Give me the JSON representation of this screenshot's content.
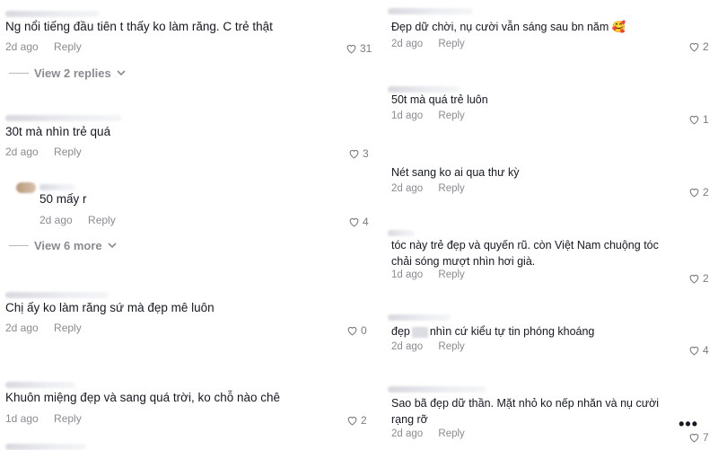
{
  "left_comments": [
    {
      "text": "Ng nổi tiếng đầu tiên t thấy ko làm răng. C trẻ thật",
      "time": "2d ago",
      "reply": "Reply",
      "likes": "31"
    },
    {
      "text": "30t mà nhìn trẻ quá",
      "time": "2d ago",
      "reply": "Reply",
      "likes": "3"
    },
    {
      "text": "50 mấy r",
      "time": "2d ago",
      "reply": "Reply",
      "likes": "4"
    },
    {
      "text": "Chị ấy ko làm răng sứ mà đẹp mê luôn",
      "time": "2d ago",
      "reply": "Reply",
      "likes": "0"
    },
    {
      "text": "Khuôn miệng đẹp và sang quá trời, ko chỗ nào chê",
      "time": "1d ago",
      "reply": "Reply",
      "likes": "2"
    }
  ],
  "view_replies": [
    "View 2 replies",
    "View 6 more"
  ],
  "right_comments": [
    {
      "text": "Đẹp dữ chời, nụ cười vẫn sáng sau bn năm 🥰",
      "time": "2d ago",
      "reply": "Reply",
      "likes": "2"
    },
    {
      "text": "50t mà quá trẻ luôn",
      "time": "1d ago",
      "reply": "Reply",
      "likes": "1"
    },
    {
      "text": "Nét sang ko ai qua thư kỳ",
      "time": "2d ago",
      "reply": "Reply",
      "likes": "2"
    },
    {
      "text": "tóc này trẻ đẹp và quyến rũ. còn Việt Nam chuộng tóc chải sóng mượt nhìn hơi già.",
      "time": "1d ago",
      "reply": "Reply",
      "likes": "2"
    },
    {
      "text_before": "đẹp",
      "text_after": "nhìn cứ kiểu tự tin phóng khoáng",
      "time": "2d ago",
      "reply": "Reply",
      "likes": "4"
    },
    {
      "text": "Sao bã đẹp dữ thần. Mặt nhỏ ko nếp nhăn và nụ cười rạng rỡ",
      "time": "2d ago",
      "reply": "Reply",
      "likes": "7"
    }
  ],
  "more_label": "•••",
  "icons": {
    "like": "heart-outline-icon",
    "expand": "chevron-down-icon",
    "more": "more-dots-icon"
  },
  "colors": {
    "text": "#161823",
    "meta": "#8a8b91",
    "background": "#ffffff"
  }
}
